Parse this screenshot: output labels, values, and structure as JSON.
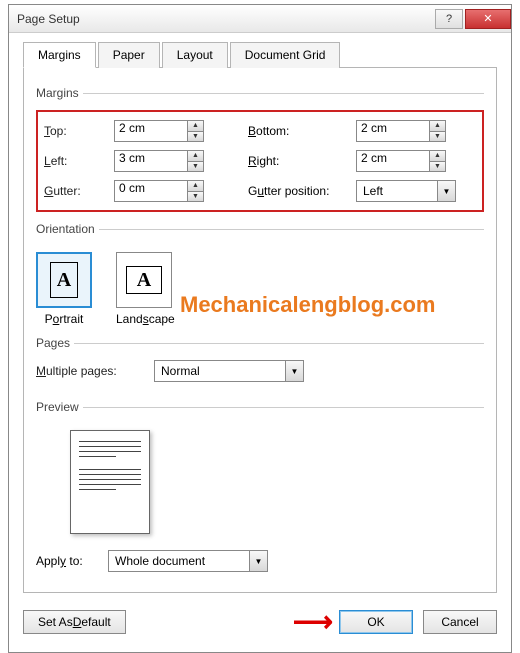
{
  "window": {
    "title": "Page Setup"
  },
  "tabs": [
    "Margins",
    "Paper",
    "Layout",
    "Document Grid"
  ],
  "margins": {
    "legend": "Margins",
    "top_label": "Top:",
    "top_value": "2 cm",
    "bottom_label": "Bottom:",
    "bottom_value": "2 cm",
    "left_label": "Left:",
    "left_value": "3 cm",
    "right_label": "Right:",
    "right_value": "2 cm",
    "gutter_label": "Gutter:",
    "gutter_value": "0 cm",
    "gutterpos_label": "Gutter position:",
    "gutterpos_value": "Left"
  },
  "orientation": {
    "legend": "Orientation",
    "portrait": "Portrait",
    "landscape": "Landscape"
  },
  "pages": {
    "legend": "Pages",
    "multiple_label": "Multiple pages:",
    "multiple_value": "Normal"
  },
  "preview": {
    "legend": "Preview"
  },
  "apply": {
    "label": "Apply to:",
    "value": "Whole document"
  },
  "buttons": {
    "default": "Set As Default",
    "ok": "OK",
    "cancel": "Cancel"
  },
  "annotation": {
    "watermark": "Mechanicalengblog.com"
  }
}
